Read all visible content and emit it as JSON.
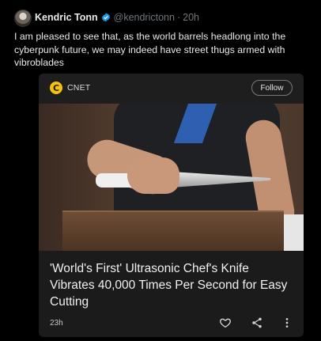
{
  "tweet": {
    "display_name": "Kendric Tonn",
    "handle": "@kendrictonn",
    "separator": "·",
    "time": "20h",
    "text": "I am pleased to see that, as the world barrels headlong into the cyberpunk future, we may indeed have street thugs armed with vibroblades"
  },
  "card": {
    "source_name": "CNET",
    "source_logo_letter": "C",
    "follow_label": "Follow",
    "headline": "'World's First' Ultrasonic Chef's Knife Vibrates 40,000 Times Per Second for Easy Cutting",
    "time": "23h"
  },
  "colors": {
    "background": "#000000",
    "text": "#e7e9ea",
    "muted": "#71767b",
    "verified_blue": "#1d9bf0",
    "card_bg": "#1b1b1c",
    "cnet_yellow": "#f4c20d"
  },
  "icons": {
    "verified": "verified-badge-icon",
    "like": "heart-icon",
    "share": "share-icon",
    "more": "more-vertical-icon"
  }
}
